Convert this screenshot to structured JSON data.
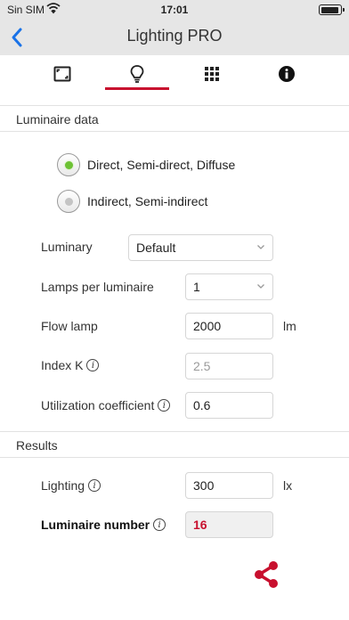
{
  "status_bar": {
    "carrier": "Sin SIM",
    "time": "17:01"
  },
  "nav": {
    "title": "Lighting PRO"
  },
  "tabs": [
    {
      "name": "area",
      "icon": "area-icon"
    },
    {
      "name": "lighting",
      "icon": "lightbulb-icon",
      "active": true
    },
    {
      "name": "grid",
      "icon": "grid-icon"
    },
    {
      "name": "info",
      "icon": "info-icon"
    }
  ],
  "luminaire_data": {
    "header": "Luminaire data",
    "radio_options": [
      {
        "label": "Direct, Semi-direct, Diffuse",
        "selected": true
      },
      {
        "label": "Indirect, Semi-indirect",
        "selected": false
      }
    ],
    "luminary": {
      "label": "Luminary",
      "value": "Default"
    },
    "lamps_per_luminaire": {
      "label": "Lamps per luminaire",
      "value": "1"
    },
    "flow_lamp": {
      "label": "Flow lamp",
      "value": "2000",
      "unit": "lm"
    },
    "index_k": {
      "label": "Index K",
      "value": "2.5"
    },
    "utilization_coefficient": {
      "label": "Utilization coefficient",
      "value": "0.6"
    }
  },
  "results": {
    "header": "Results",
    "lighting": {
      "label": "Lighting",
      "value": "300",
      "unit": "lx"
    },
    "luminaire_number": {
      "label": "Luminaire number",
      "value": "16"
    }
  },
  "colors": {
    "accent": "#c8102e",
    "ios_blue": "#1a73e8",
    "radio_on": "#6dc234"
  }
}
